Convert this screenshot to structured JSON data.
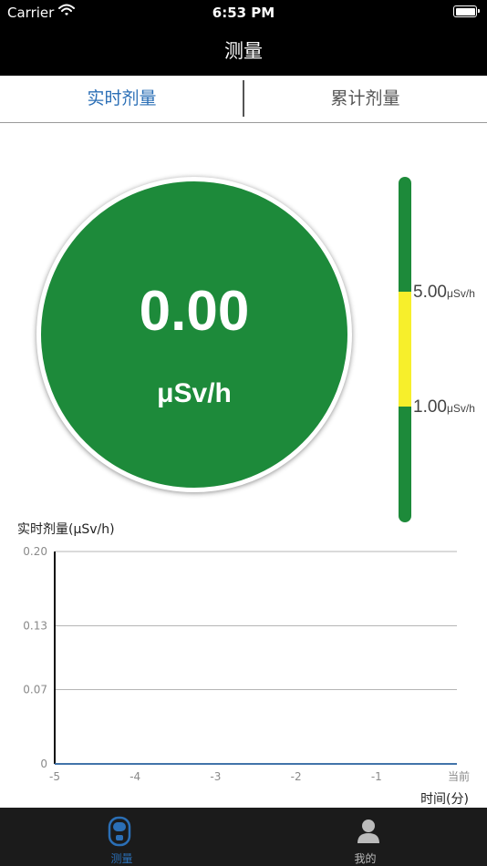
{
  "status": {
    "carrier": "Carrier",
    "time": "6:53 PM"
  },
  "nav": {
    "title": "测量"
  },
  "tabs": [
    {
      "label": "实时剂量",
      "active": true
    },
    {
      "label": "累计剂量",
      "active": false
    }
  ],
  "gauge": {
    "value": "0.00",
    "unit": "μSv/h",
    "color": "#1d8a3a"
  },
  "scale": {
    "labels": [
      {
        "value": "5.00",
        "unit": "μSv/h"
      },
      {
        "value": "1.00",
        "unit": "μSv/h"
      }
    ],
    "colors": {
      "green": "#1d8a3a",
      "yellow": "#f7ef2b"
    }
  },
  "chart_data": {
    "type": "line",
    "ylabel": "实时剂量(μSv/h)",
    "xlabel": "时间(分)",
    "x_ticks": [
      "-5",
      "-4",
      "-3",
      "-2",
      "-1",
      "当前"
    ],
    "y_ticks": [
      "0",
      "0.07",
      "0.13",
      "0.20"
    ],
    "ylim": [
      0,
      0.2
    ],
    "xlim": [
      -5,
      0
    ],
    "grid": true,
    "series": [
      {
        "x": [
          -5,
          0
        ],
        "y": [
          0,
          0
        ],
        "color": "#2b6fb6"
      }
    ]
  },
  "bottom_tabs": [
    {
      "label": "测量",
      "icon": "detector-icon",
      "active": true,
      "color": "#2b6fb6"
    },
    {
      "label": "我的",
      "icon": "person-icon",
      "active": false,
      "color": "#bbbbbb"
    }
  ]
}
